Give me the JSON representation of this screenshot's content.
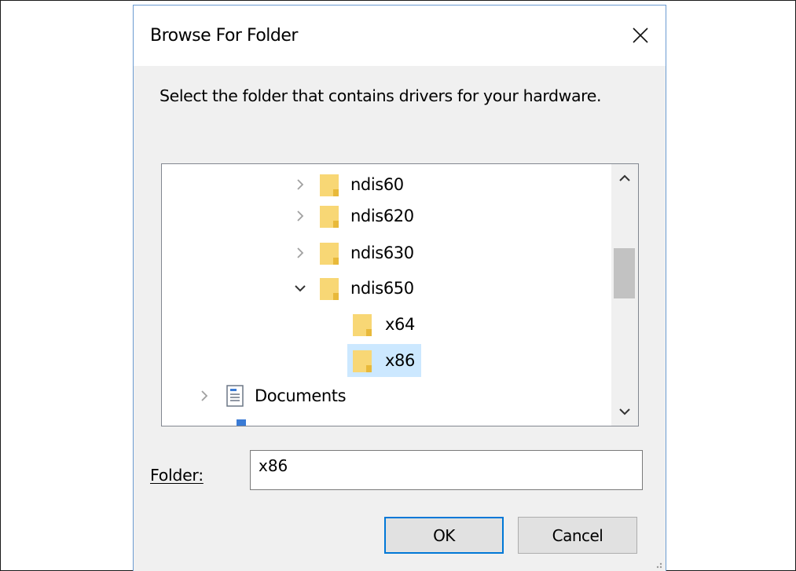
{
  "window": {
    "title": "Browse For Folder",
    "close_icon": "close-icon"
  },
  "instruction": "Select the folder that contains drivers for your hardware.",
  "tree": {
    "items": [
      {
        "label": "ndis60",
        "expander": "chevron-right-icon",
        "icon": "folder-icon"
      },
      {
        "label": "ndis620",
        "expander": "chevron-right-icon",
        "icon": "folder-icon"
      },
      {
        "label": "ndis630",
        "expander": "chevron-right-icon",
        "icon": "folder-icon"
      },
      {
        "label": "ndis650",
        "expander": "chevron-down-icon",
        "icon": "folder-icon"
      },
      {
        "label": "x64",
        "expander": "",
        "icon": "folder-icon"
      },
      {
        "label": "x86",
        "expander": "",
        "icon": "folder-icon",
        "selected": true
      },
      {
        "label": "Documents",
        "expander": "chevron-right-icon",
        "icon": "documents-icon"
      }
    ]
  },
  "folder_field": {
    "label": "Folder:",
    "value": "x86"
  },
  "buttons": {
    "ok": "OK",
    "cancel": "Cancel"
  },
  "colors": {
    "accent": "#0078d7",
    "selection": "#cce8ff",
    "folder_body": "#f8d775",
    "folder_shade": "#e8b93a"
  }
}
